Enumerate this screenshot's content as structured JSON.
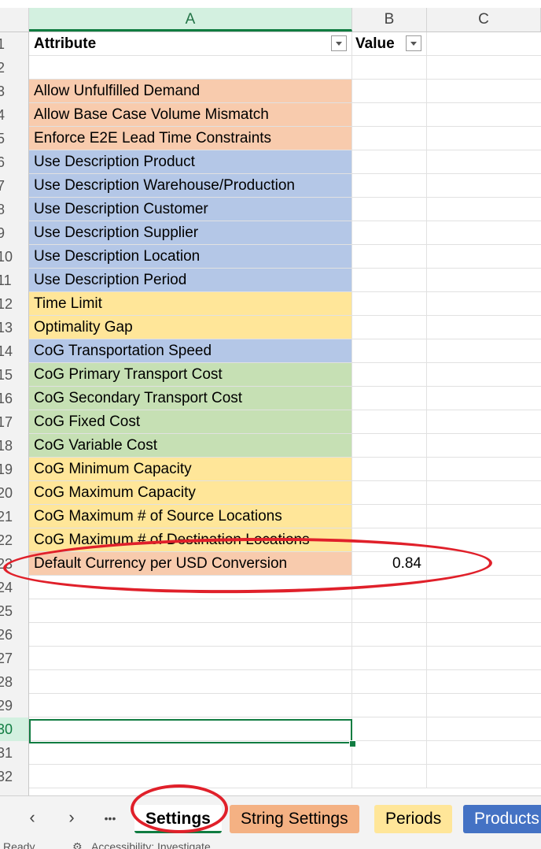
{
  "columns": [
    "A",
    "B",
    "C"
  ],
  "header": {
    "attribute_label": "Attribute",
    "value_label": "Value"
  },
  "rows": [
    {
      "num": "2",
      "text": "",
      "value": "",
      "color": ""
    },
    {
      "num": "3",
      "text": "Allow Unfulfilled Demand",
      "value": "",
      "color": "orange"
    },
    {
      "num": "4",
      "text": "Allow Base Case Volume Mismatch",
      "value": "",
      "color": "orange"
    },
    {
      "num": "5",
      "text": "Enforce E2E Lead Time Constraints",
      "value": "",
      "color": "orange"
    },
    {
      "num": "6",
      "text": "Use Description Product",
      "value": "",
      "color": "blue"
    },
    {
      "num": "7",
      "text": "Use Description Warehouse/Production",
      "value": "",
      "color": "blue"
    },
    {
      "num": "8",
      "text": "Use Description Customer",
      "value": "",
      "color": "blue"
    },
    {
      "num": "9",
      "text": "Use Description Supplier",
      "value": "",
      "color": "blue"
    },
    {
      "num": "10",
      "text": "Use Description Location",
      "value": "",
      "color": "blue"
    },
    {
      "num": "11",
      "text": "Use Description Period",
      "value": "",
      "color": "blue"
    },
    {
      "num": "12",
      "text": "Time Limit",
      "value": "",
      "color": "yellow"
    },
    {
      "num": "13",
      "text": "Optimality Gap",
      "value": "",
      "color": "yellow"
    },
    {
      "num": "14",
      "text": "CoG Transportation Speed",
      "value": "",
      "color": "blue"
    },
    {
      "num": "15",
      "text": "CoG Primary Transport Cost",
      "value": "",
      "color": "green"
    },
    {
      "num": "16",
      "text": "CoG Secondary Transport Cost",
      "value": "",
      "color": "green"
    },
    {
      "num": "17",
      "text": "CoG Fixed Cost",
      "value": "",
      "color": "green"
    },
    {
      "num": "18",
      "text": "CoG Variable Cost",
      "value": "",
      "color": "green"
    },
    {
      "num": "19",
      "text": "CoG Minimum Capacity",
      "value": "",
      "color": "yellow"
    },
    {
      "num": "20",
      "text": "CoG Maximum Capacity",
      "value": "",
      "color": "yellow"
    },
    {
      "num": "21",
      "text": "CoG Maximum # of Source Locations",
      "value": "",
      "color": "yellow"
    },
    {
      "num": "22",
      "text": "CoG Maximum # of Destination Locations",
      "value": "",
      "color": "yellow"
    },
    {
      "num": "23",
      "text": "Default Currency per USD Conversion",
      "value": "0.84",
      "color": "orange"
    },
    {
      "num": "24",
      "text": "",
      "value": "",
      "color": ""
    },
    {
      "num": "25",
      "text": "",
      "value": "",
      "color": ""
    },
    {
      "num": "26",
      "text": "",
      "value": "",
      "color": ""
    },
    {
      "num": "27",
      "text": "",
      "value": "",
      "color": ""
    },
    {
      "num": "28",
      "text": "",
      "value": "",
      "color": ""
    },
    {
      "num": "29",
      "text": "",
      "value": "",
      "color": ""
    },
    {
      "num": "30",
      "text": "",
      "value": "",
      "color": ""
    },
    {
      "num": "31",
      "text": "",
      "value": "",
      "color": ""
    },
    {
      "num": "32",
      "text": "",
      "value": "",
      "color": ""
    }
  ],
  "first_row_num": "1",
  "active_row": "30",
  "tabs": [
    {
      "label": "Settings",
      "style": "active"
    },
    {
      "label": "String Settings",
      "style": "orange"
    },
    {
      "label": "Periods",
      "style": "yellow"
    },
    {
      "label": "Products",
      "style": "blue"
    }
  ],
  "nav": {
    "prev_icon": "chevron-left-icon",
    "next_icon": "chevron-right-icon",
    "more_icon": "more-icon",
    "prev": "‹",
    "next": "›",
    "more": "•••"
  },
  "status": {
    "ready": "Ready",
    "accessibility": "Accessibility: Investigate"
  },
  "colors": {
    "orange": "#f8cbad",
    "blue": "#b4c7e7",
    "yellow": "#ffe699",
    "green": "#c6e0b4",
    "annotation": "#e0202a",
    "selection": "#107c41"
  }
}
